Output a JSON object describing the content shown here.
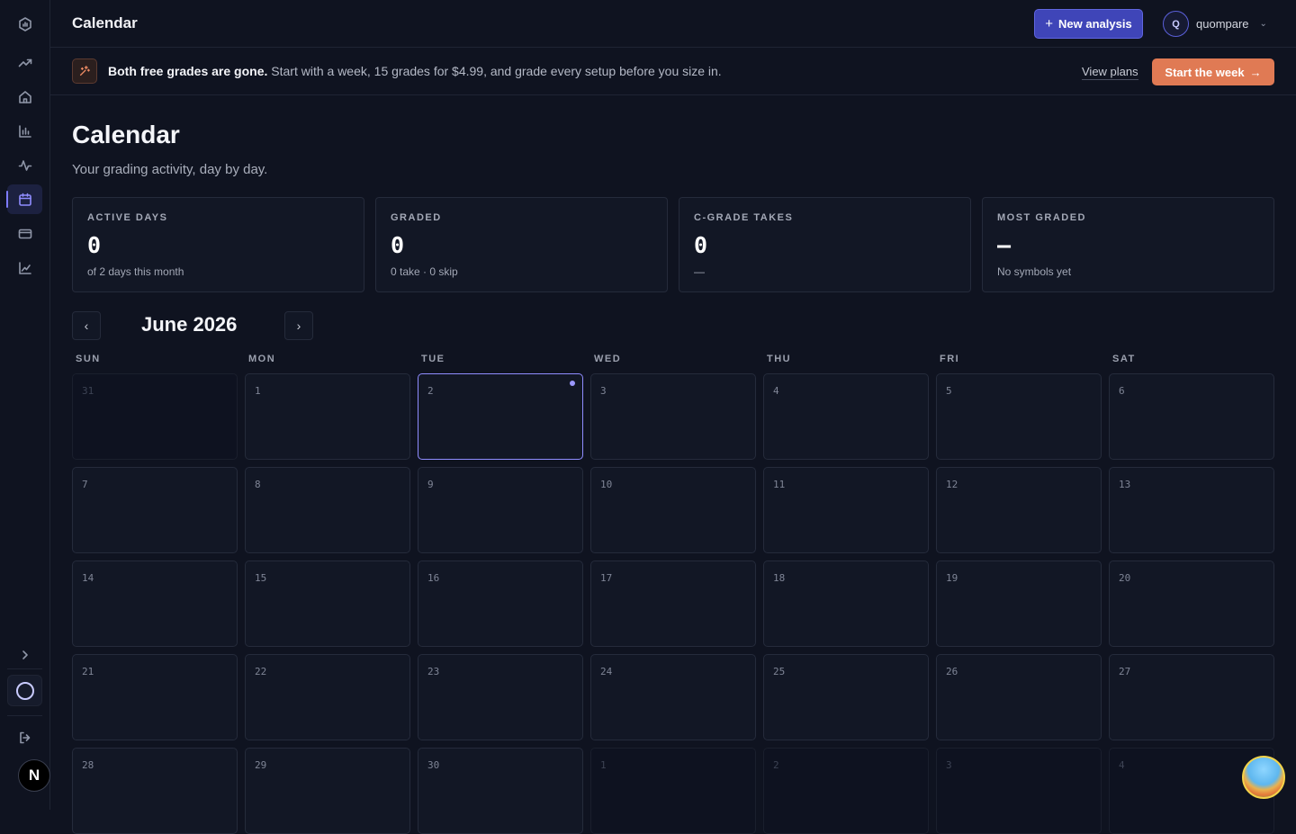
{
  "topbar": {
    "title": "Calendar",
    "new_analysis_label": "New analysis",
    "user": {
      "initial": "Q",
      "name": "quompare"
    }
  },
  "banner": {
    "bold_text": "Both free grades are gone.",
    "text": "Start with a week, 15 grades for $4.99, and grade every setup before you size in.",
    "view_plans": "View plans",
    "cta": "Start the week"
  },
  "page": {
    "title": "Calendar",
    "subtitle": "Your grading activity, day by day."
  },
  "stats": [
    {
      "label": "ACTIVE DAYS",
      "value": "0",
      "note": "of 2 days this month"
    },
    {
      "label": "GRADED",
      "value": "0",
      "note": "0 take · 0 skip"
    },
    {
      "label": "C-GRADE TAKES",
      "value": "0",
      "note": "—"
    },
    {
      "label": "MOST GRADED",
      "value": "–",
      "note": "No symbols yet"
    }
  ],
  "calendar": {
    "month": "June 2026",
    "weekdays": [
      "SUN",
      "MON",
      "TUE",
      "WED",
      "THU",
      "FRI",
      "SAT"
    ],
    "weeks": [
      [
        {
          "d": "31",
          "out": true
        },
        {
          "d": "1"
        },
        {
          "d": "2",
          "today": true
        },
        {
          "d": "3"
        },
        {
          "d": "4"
        },
        {
          "d": "5"
        },
        {
          "d": "6"
        }
      ],
      [
        {
          "d": "7"
        },
        {
          "d": "8"
        },
        {
          "d": "9"
        },
        {
          "d": "10"
        },
        {
          "d": "11"
        },
        {
          "d": "12"
        },
        {
          "d": "13"
        }
      ],
      [
        {
          "d": "14"
        },
        {
          "d": "15"
        },
        {
          "d": "16"
        },
        {
          "d": "17"
        },
        {
          "d": "18"
        },
        {
          "d": "19"
        },
        {
          "d": "20"
        }
      ],
      [
        {
          "d": "21"
        },
        {
          "d": "22"
        },
        {
          "d": "23"
        },
        {
          "d": "24"
        },
        {
          "d": "25"
        },
        {
          "d": "26"
        },
        {
          "d": "27"
        }
      ],
      [
        {
          "d": "28"
        },
        {
          "d": "29"
        },
        {
          "d": "30"
        },
        {
          "d": "1",
          "out": true
        },
        {
          "d": "2",
          "out": true
        },
        {
          "d": "3",
          "out": true
        },
        {
          "d": "4",
          "out": true
        }
      ]
    ]
  },
  "sidebar": {
    "items": [
      "logo-icon",
      "trending-icon",
      "home-icon",
      "bar-chart-icon",
      "activity-icon",
      "calendar-icon",
      "card-icon",
      "line-chart-icon"
    ],
    "active": "calendar-icon"
  },
  "badge": {
    "letter": "N"
  }
}
